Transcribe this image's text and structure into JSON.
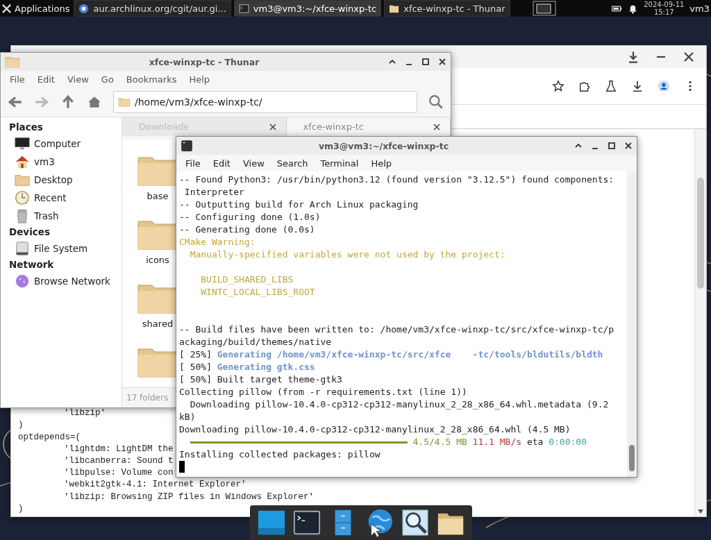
{
  "panel": {
    "menu_label": "Applications",
    "tasks": [
      {
        "title": "aur.archlinux.org/cgit/aur.gi...",
        "kind": "browser",
        "selected": false
      },
      {
        "title": "vm3@vm3:~/xfce-winxp-tc",
        "kind": "terminal",
        "selected": true
      },
      {
        "title": "xfce-winxp-tc - Thunar",
        "kind": "folder",
        "selected": false
      }
    ],
    "date": "2024-09-11",
    "time": "15:17",
    "user": "vm3"
  },
  "browser": {
    "lines": [
      {
        "text": "'libzip'",
        "kind": "item"
      },
      {
        "text": ")",
        "kind": "plain"
      },
      {
        "text": "optdepends=(",
        "kind": "plain"
      },
      {
        "text": "'lightdm: LightDM the",
        "kind": "item"
      },
      {
        "text": "'libcanberra: Sound t",
        "kind": "item"
      },
      {
        "text": "'libpulse: Volume con",
        "kind": "item"
      },
      {
        "text": "'webkit2gtk-4.1: Internet Explorer'",
        "kind": "item"
      },
      {
        "text": "'libzip: Browsing ZIP files in Windows Explorer'",
        "kind": "item"
      },
      {
        "text": ")",
        "kind": "plain"
      }
    ]
  },
  "thunar": {
    "title": "xfce-winxp-tc - Thunar",
    "menu": [
      "File",
      "Edit",
      "View",
      "Go",
      "Bookmarks",
      "Help"
    ],
    "path": "/home/vm3/xfce-winxp-tc/",
    "sidebar": [
      {
        "heading": "Places",
        "items": [
          {
            "label": "Computer",
            "kind": "computer"
          },
          {
            "label": "vm3",
            "kind": "home"
          },
          {
            "label": "Desktop",
            "kind": "folder"
          },
          {
            "label": "Recent",
            "kind": "recent"
          },
          {
            "label": "Trash",
            "kind": "trash"
          }
        ]
      },
      {
        "heading": "Devices",
        "items": [
          {
            "label": "File System",
            "kind": "drive"
          }
        ]
      },
      {
        "heading": "Network",
        "items": [
          {
            "label": "Browse Network",
            "kind": "network"
          }
        ]
      }
    ],
    "tabs": [
      {
        "label": "Downloads",
        "selected": false
      },
      {
        "label": "xfce-winxp-tc",
        "selected": true
      }
    ],
    "folders": [
      {
        "name": "base",
        "kind": "folder"
      },
      {
        "name": "icons",
        "kind": "folder"
      },
      {
        "name": "shared",
        "kind": "folder"
      },
      {
        "kind": "folder"
      }
    ],
    "status": "17 folders"
  },
  "terminal": {
    "title": "vm3@vm3:~/xfce-winxp-tc",
    "menu": [
      "File",
      "Edit",
      "View",
      "Search",
      "Terminal",
      "Help"
    ],
    "lines": [
      {
        "kind": "text",
        "segments": [
          {
            "text": "-- Found Python3: /usr/bin/python3.12 (found version \"3.12.5\") found components:",
            "kind": "plain"
          }
        ]
      },
      {
        "kind": "wrap",
        "segments": [
          {
            "text": "Interpreter",
            "kind": "plain"
          }
        ]
      },
      {
        "kind": "text",
        "segments": [
          {
            "text": "-- Outputting build for Arch Linux packaging",
            "kind": "plain"
          }
        ]
      },
      {
        "kind": "text",
        "segments": [
          {
            "text": "-- Configuring done (1.0s)",
            "kind": "plain"
          }
        ]
      },
      {
        "kind": "text",
        "segments": [
          {
            "text": "-- Generating done (0.0s)",
            "kind": "plain"
          }
        ]
      },
      {
        "kind": "text",
        "segments": [
          {
            "text": "CMake Warning:",
            "kind": "warning"
          }
        ]
      },
      {
        "kind": "sub",
        "segments": [
          {
            "text": "Manually-specified variables were not used by the project:",
            "kind": "warning"
          }
        ]
      },
      {
        "kind": "blank"
      },
      {
        "kind": "var",
        "segments": [
          {
            "text": "BUILD_SHARED_LIBS",
            "kind": "warning"
          }
        ]
      },
      {
        "kind": "var",
        "segments": [
          {
            "text": "WINTC_LOCAL_LIBS_ROOT",
            "kind": "warning"
          }
        ]
      },
      {
        "kind": "blank"
      },
      {
        "kind": "blank"
      },
      {
        "kind": "text",
        "segments": [
          {
            "text": "-- Build files have been written to: /home/vm3/xfce-winxp-tc/src/xfce-winxp-tc/p",
            "kind": "plain"
          }
        ]
      },
      {
        "kind": "text",
        "segments": [
          {
            "text": "ackaging/build/themes/native",
            "kind": "plain"
          }
        ]
      },
      {
        "kind": "text",
        "segments": [
          {
            "text": "[ 25%]",
            "kind": "plain"
          },
          {
            "text": "Generating /home/vm3/xfce-winxp-tc/src/xfce",
            "kind": "info"
          },
          {
            "text": "-tc/tools/bldutils/bldth",
            "kind": "info_gap"
          }
        ]
      },
      {
        "kind": "text",
        "segments": [
          {
            "text": "[ 50%]",
            "kind": "plain"
          },
          {
            "text": "Generating gtk.css",
            "kind": "info"
          }
        ]
      },
      {
        "kind": "text",
        "segments": [
          {
            "text": "[ 50%] Built target theme-gtk3",
            "kind": "plain"
          }
        ]
      },
      {
        "kind": "text",
        "segments": [
          {
            "text": "Collecting pillow (from -r requirements.txt (line 1))",
            "kind": "plain"
          }
        ]
      },
      {
        "kind": "sub",
        "segments": [
          {
            "text": "Downloading pillow-10.4.0-cp312-cp312-manylinux_2_28_x86_64.whl.metadata (9.2",
            "kind": "plain"
          }
        ]
      },
      {
        "kind": "text",
        "segments": [
          {
            "text": "kB)",
            "kind": "plain"
          }
        ]
      },
      {
        "kind": "text",
        "segments": [
          {
            "text": "Downloading pillow-10.4.0-cp312-cp312-manylinux_2_28_x86_64.whl (4.5 MB)",
            "kind": "plain"
          }
        ]
      },
      {
        "kind": "progress",
        "segments": [
          {
            "text": "4.5/4.5 MB",
            "kind": "green"
          },
          {
            "text": "11.1 MB/s",
            "kind": "red"
          },
          {
            "text": "eta",
            "kind": "plain"
          },
          {
            "text": "0:00:00",
            "kind": "cyan"
          }
        ]
      },
      {
        "kind": "text",
        "segments": [
          {
            "text": "Installing collected packages: pillow",
            "kind": "plain"
          }
        ]
      },
      {
        "kind": "cursor"
      }
    ]
  },
  "dock": {
    "items": [
      {
        "kind": "desktop"
      },
      {
        "kind": "terminal"
      },
      {
        "kind": "cabinet"
      },
      {
        "kind": "globe"
      },
      {
        "kind": "search"
      },
      {
        "kind": "folder"
      }
    ]
  }
}
